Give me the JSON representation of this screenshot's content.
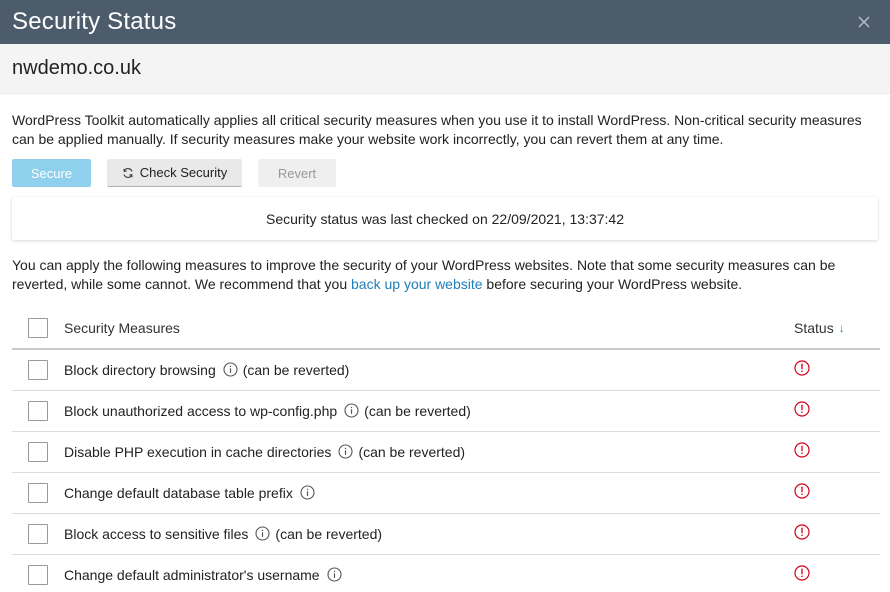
{
  "dialog": {
    "title": "Security Status",
    "close_icon": "close-icon"
  },
  "site": {
    "name": "nwdemo.co.uk"
  },
  "intro_text": "WordPress Toolkit automatically applies all critical security measures when you use it to install WordPress. Non-critical security measures can be applied manually. If security measures make your website work incorrectly, you can revert them at any time.",
  "toolbar": {
    "secure_label": "Secure",
    "check_label": "Check Security",
    "check_icon": "refresh-icon",
    "revert_label": "Revert"
  },
  "status_message": "Security status was last checked on 22/09/2021, 13:37:42",
  "measures_info": {
    "before": "You can apply the following measures to improve the security of your WordPress websites. Note that some security measures can be reverted, while some cannot. We recommend that you ",
    "link": "back up your website",
    "after": " before securing your WordPress website."
  },
  "table": {
    "headers": {
      "measures": "Security Measures",
      "status": "Status",
      "sort_indicator": "↓"
    },
    "rows": [
      {
        "label": "Block directory browsing",
        "note": "(can be reverted)",
        "status": "warning"
      },
      {
        "label": "Block unauthorized access to wp-config.php",
        "note": "(can be reverted)",
        "status": "warning"
      },
      {
        "label": "Disable PHP execution in cache directories",
        "note": "(can be reverted)",
        "status": "warning"
      },
      {
        "label": "Change default database table prefix",
        "note": "",
        "status": "warning"
      },
      {
        "label": "Block access to sensitive files",
        "note": "(can be reverted)",
        "status": "warning"
      },
      {
        "label": "Change default administrator's username",
        "note": "",
        "status": "warning"
      }
    ]
  },
  "colors": {
    "titlebar": "#4c5c6b",
    "accent": "#1f7fb6",
    "secure_button": "#8fd0ec",
    "warning": "#d0021b"
  }
}
